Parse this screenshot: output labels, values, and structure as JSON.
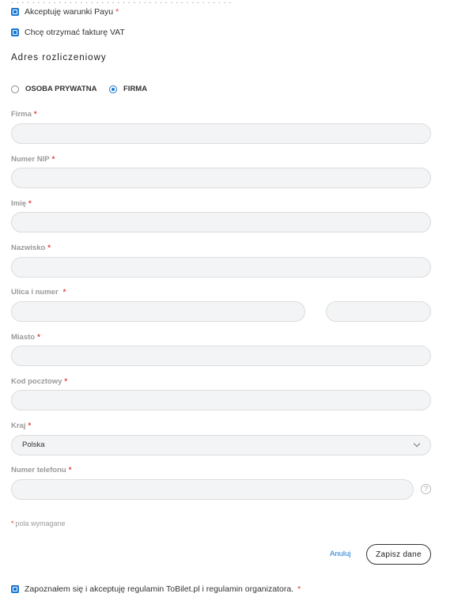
{
  "consents": {
    "payu_label": "Akceptuję warunki Payu",
    "vat_label": "Chcę otrzymać fakturę VAT",
    "terms_label": "Zapoznałem się i akceptuję regulamin ToBilet.pl i regulamin organizatora.",
    "required_mark": "*"
  },
  "billing": {
    "title": "Adres rozliczeniowy",
    "type_private": "OSOBA PRYWATNA",
    "type_company": "FIRMA",
    "selected_type": "FIRMA"
  },
  "fields": {
    "company": {
      "label": "Firma",
      "value": ""
    },
    "nip": {
      "label": "Numer NIP",
      "value": ""
    },
    "first_name": {
      "label": "Imię",
      "value": ""
    },
    "last_name": {
      "label": "Nazwisko",
      "value": ""
    },
    "street": {
      "label": "Ulica i numer",
      "value": "",
      "number_value": ""
    },
    "city": {
      "label": "Miasto",
      "value": ""
    },
    "postal": {
      "label": "Kod pocztowy",
      "value": ""
    },
    "country": {
      "label": "Kraj",
      "value": "Polska"
    },
    "phone": {
      "label": "Numer telefonu",
      "value": ""
    }
  },
  "help_icon": "?",
  "required_note": "pola wymagane",
  "actions": {
    "cancel_label": "Anuluj",
    "save_label": "Zapisz dane"
  },
  "colors": {
    "accent": "#1976d2",
    "required": "#e53935",
    "field_bg": "#f3f4f6"
  }
}
